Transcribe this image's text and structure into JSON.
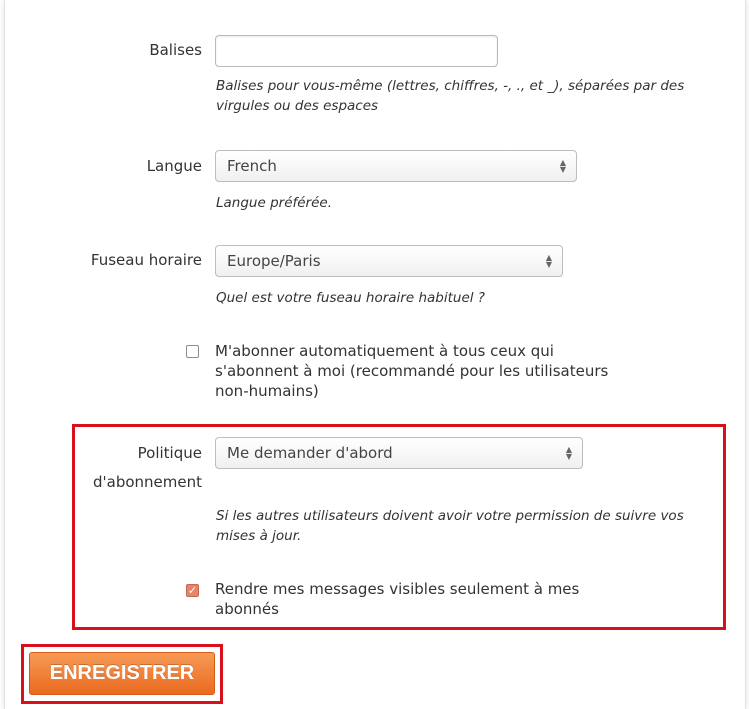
{
  "tags": {
    "label": "Balises",
    "value": "",
    "help": "Balises pour vous-même (lettres, chiffres, -, ., et _), séparées par des virgules ou des espaces"
  },
  "language": {
    "label": "Langue",
    "selected": "French",
    "help": "Langue préférée."
  },
  "timezone": {
    "label": "Fuseau horaire",
    "selected": "Europe/Paris",
    "help": "Quel est votre fuseau horaire habituel ?"
  },
  "autosubscribe": {
    "checked": false,
    "label": "M'abonner automatiquement à tous ceux qui s'abonnent à moi (recommandé pour les utilisateurs non-humains)"
  },
  "subscription_policy": {
    "label_line1": "Politique",
    "label_line2": "d'abonnement",
    "selected": "Me demander d'abord",
    "help": "Si les autres utilisateurs doivent avoir votre permission de suivre vos mises à jour."
  },
  "private_stream": {
    "checked": true,
    "label": "Rendre mes messages visibles seulement à mes abonnés"
  },
  "save_button": {
    "label": "ENREGISTRER"
  },
  "colors": {
    "highlight": "#d7101b",
    "button": "#ea6a1f",
    "checkbox_checked": "#e8836b"
  }
}
